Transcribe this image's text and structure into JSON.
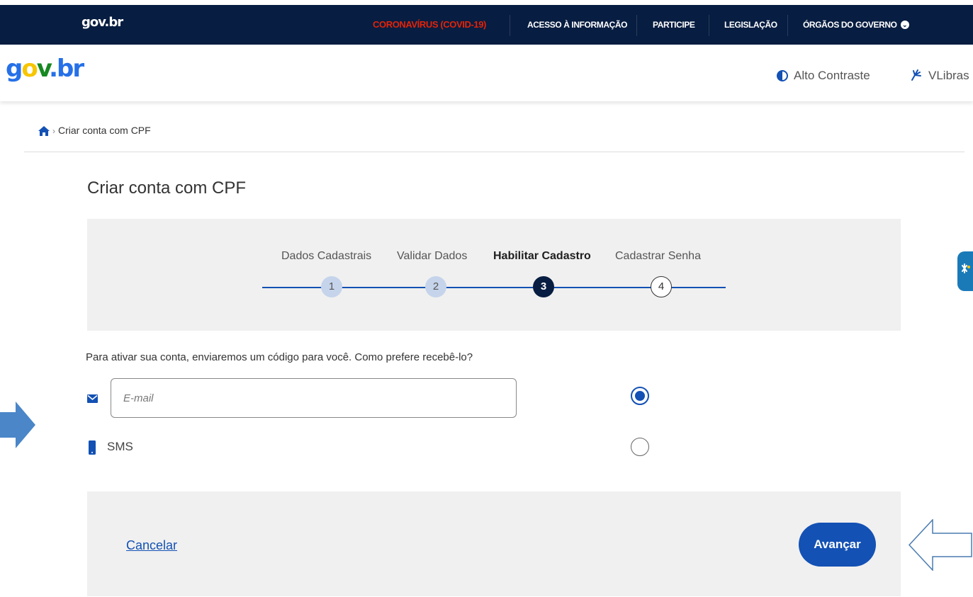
{
  "topbar": {
    "brand": "gov.br",
    "links": {
      "covid": "CORONAVÍRUS (COVID-19)",
      "acesso": "ACESSO À INFORMAÇÃO",
      "participe": "PARTICIPE",
      "legislacao": "LEGISLAÇÃO",
      "orgaos": "ÓRGÃOS DO GOVERNO"
    },
    "chevron_icon": "chevron-down-icon"
  },
  "header": {
    "logo": {
      "g": "g",
      "o": "o",
      "v": "v",
      "br": "br",
      "dot": "."
    },
    "alto_contraste": "Alto Contraste",
    "vlibras": "VLibras"
  },
  "breadcrumb": {
    "home_icon": "home-icon",
    "current": "Criar conta com CPF"
  },
  "page": {
    "title": "Criar conta com CPF"
  },
  "stepper": {
    "steps": [
      {
        "label": "Dados Cadastrais",
        "number": "1",
        "state": "done"
      },
      {
        "label": "Validar Dados",
        "number": "2",
        "state": "done"
      },
      {
        "label": "Habilitar Cadastro",
        "number": "3",
        "state": "current"
      },
      {
        "label": "Cadastrar Senha",
        "number": "4",
        "state": "todo"
      }
    ]
  },
  "form": {
    "question": "Para ativar sua conta, enviaremos um código para você. Como prefere recebê-lo?",
    "email": {
      "placeholder": "E-mail",
      "value": "",
      "selected": true,
      "icon": "envelope-icon"
    },
    "sms": {
      "label": "SMS",
      "selected": false,
      "icon": "phone-icon"
    }
  },
  "actions": {
    "cancel": "Cancelar",
    "next": "Avançar"
  },
  "colors": {
    "primary": "#1351b4",
    "dark_navy": "#071d41",
    "covid_red": "#e52207",
    "panel_bg": "#f0f0f0"
  }
}
